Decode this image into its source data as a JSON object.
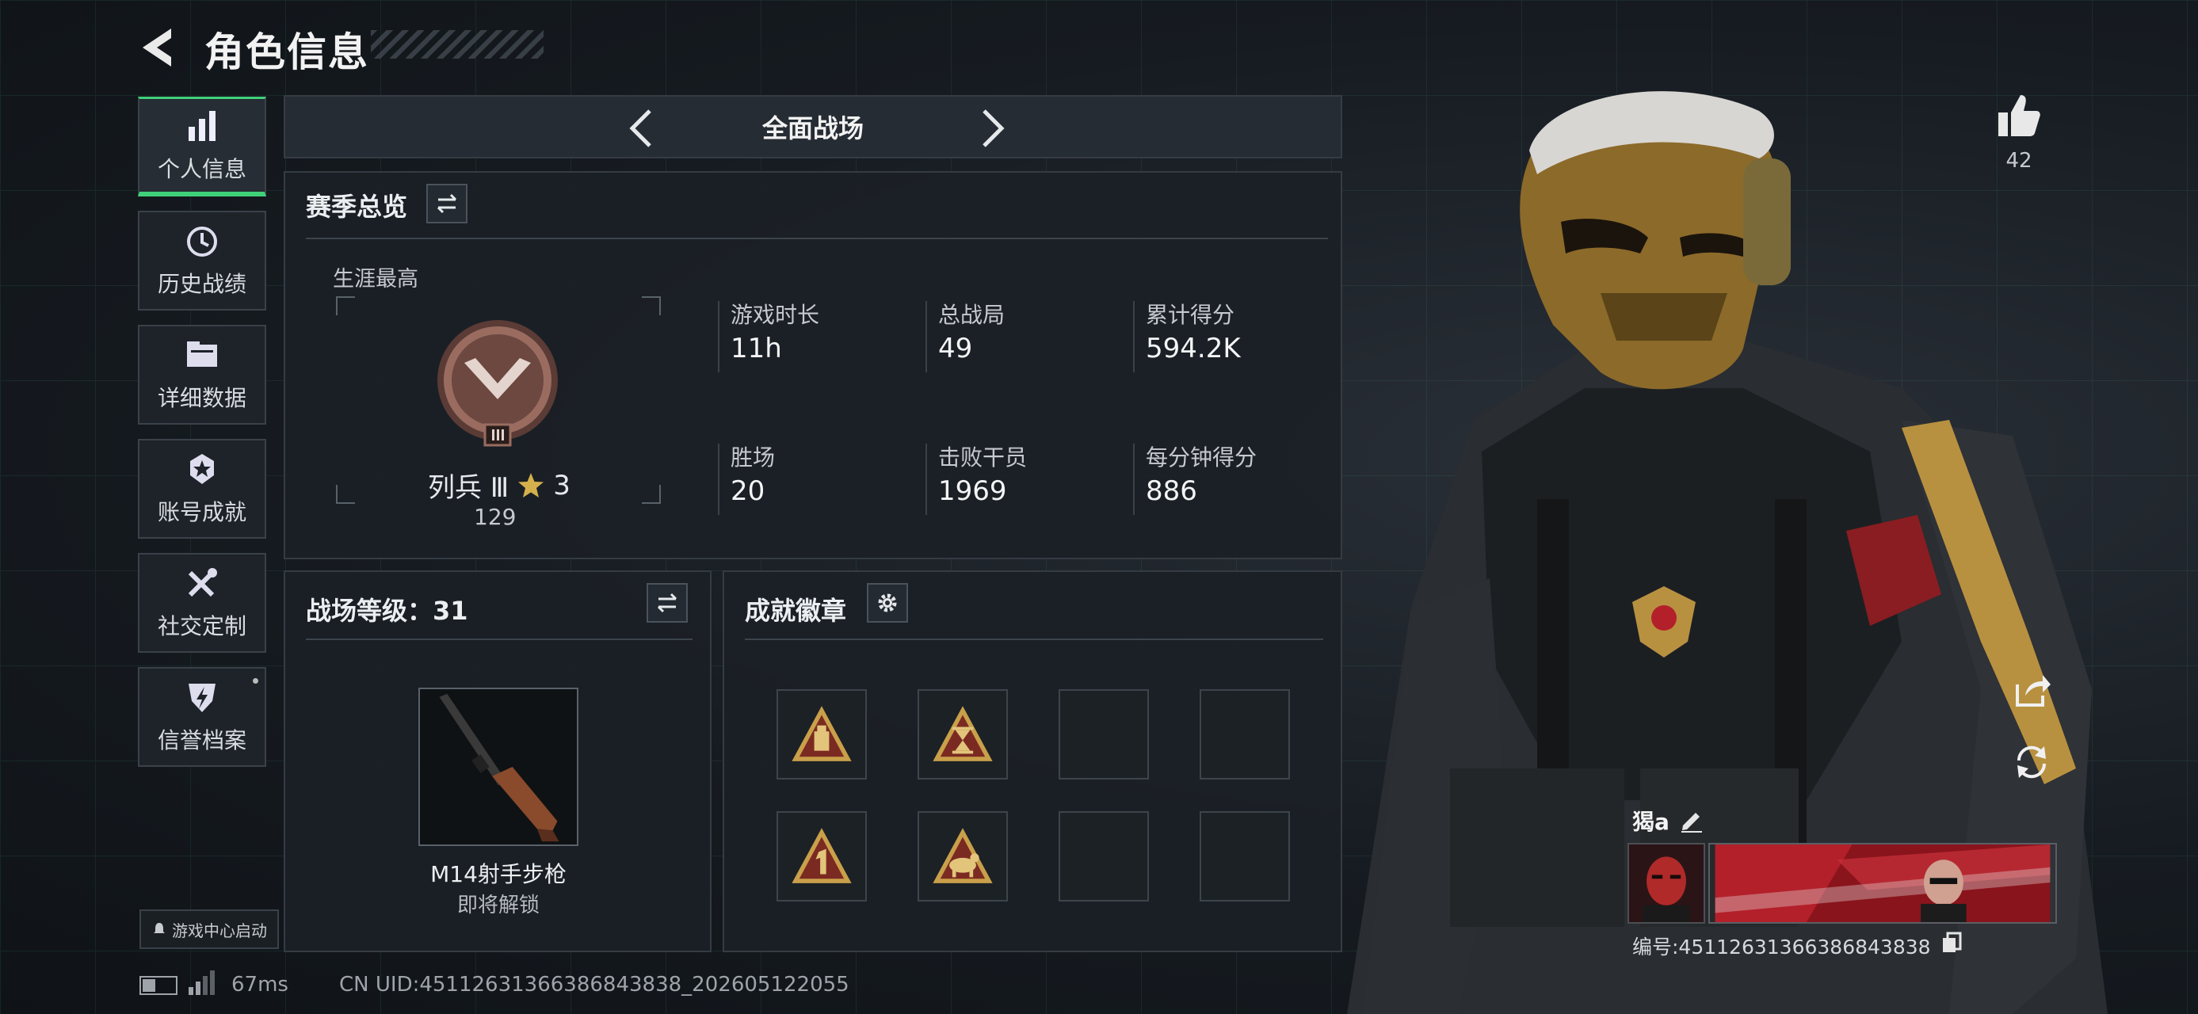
{
  "header": {
    "title": "角色信息"
  },
  "sidebar": {
    "items": [
      {
        "label": "个人信息",
        "icon": "bar-chart-icon",
        "active": true
      },
      {
        "label": "历史战绩",
        "icon": "history-clock-icon",
        "active": false
      },
      {
        "label": "详细数据",
        "icon": "folder-icon",
        "active": false
      },
      {
        "label": "账号成就",
        "icon": "medal-icon",
        "active": false
      },
      {
        "label": "社交定制",
        "icon": "tools-icon",
        "active": false
      },
      {
        "label": "信誉档案",
        "icon": "shield-bolt-icon",
        "active": false
      }
    ],
    "launch_label": "游戏中心启动"
  },
  "mode_bar": {
    "title": "全面战场"
  },
  "season": {
    "title": "赛季总览",
    "career_label": "生涯最高",
    "rank_name": "列兵 Ⅲ",
    "rank_stars": "3",
    "rank_points": "129",
    "stats": [
      {
        "label": "游戏时长",
        "value": "11h"
      },
      {
        "label": "总战局",
        "value": "49"
      },
      {
        "label": "累计得分",
        "value": "594.2K"
      },
      {
        "label": "胜场",
        "value": "20"
      },
      {
        "label": "击败干员",
        "value": "1969"
      },
      {
        "label": "每分钟得分",
        "value": "886"
      }
    ]
  },
  "battle_level": {
    "title": "战场等级：31",
    "weapon_name": "M14射手步枪",
    "weapon_status": "即将解锁"
  },
  "badges": {
    "title": "成就徽章",
    "filled": 4,
    "total": 8
  },
  "profile": {
    "likes": "42",
    "username": "猲a",
    "id_text": "编号:4511263136638684383​8"
  },
  "status_bar": {
    "ping": "67ms",
    "uid": "CN UID:4511263136638684383​8_202605122055"
  },
  "colors": {
    "accent": "#3fd17a",
    "gold": "#c9a04a",
    "panel": "#1b2026",
    "banner_red": "#b3202a"
  }
}
